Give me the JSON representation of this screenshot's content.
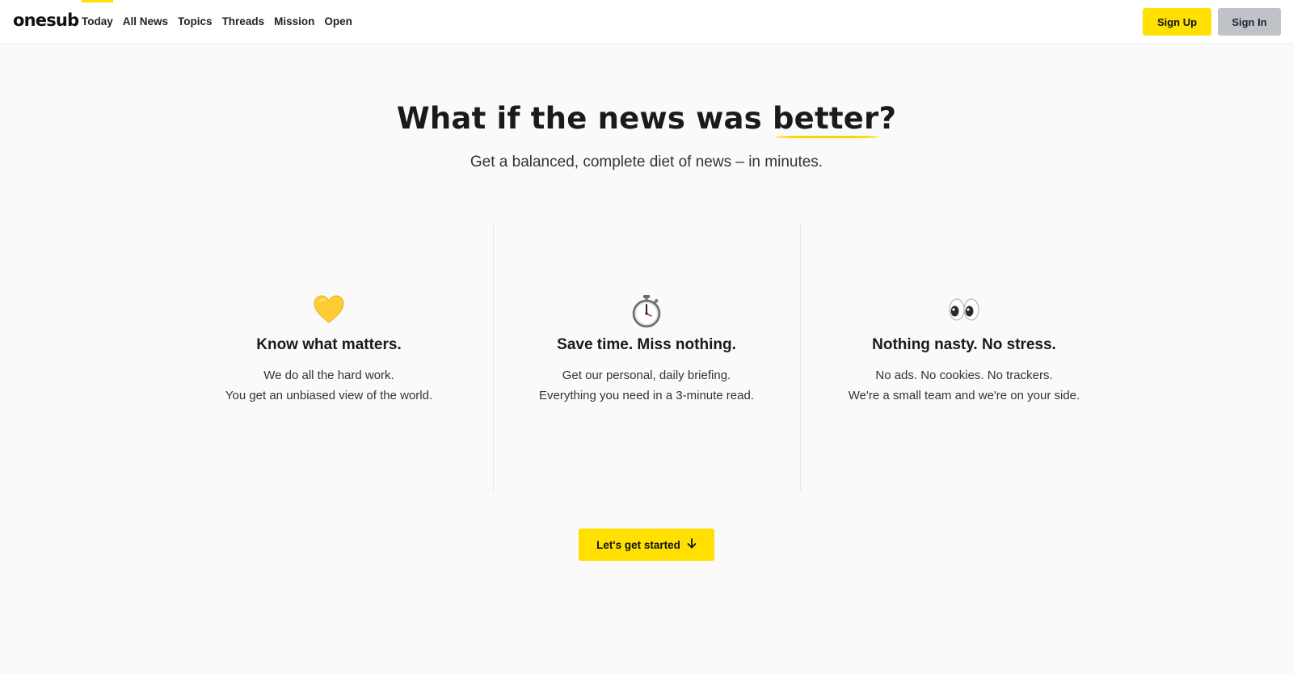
{
  "header": {
    "logo_text": "onesub",
    "nav": [
      {
        "label": "Today",
        "active": true
      },
      {
        "label": "All News"
      },
      {
        "label": "Topics"
      },
      {
        "label": "Threads"
      },
      {
        "label": "Mission"
      },
      {
        "label": "Open"
      }
    ],
    "sign_up_label": "Sign Up",
    "sign_in_label": "Sign In"
  },
  "hero": {
    "title_prefix": "What if the news was ",
    "title_highlight": "better",
    "title_suffix": "?",
    "subtitle": "Get a balanced, complete diet of news – in minutes."
  },
  "features": [
    {
      "icon": "yellow-heart-icon",
      "title": "Know what matters.",
      "line1": "We do all the hard work.",
      "line2": "You get an unbiased view of the world."
    },
    {
      "icon": "stopwatch-icon",
      "title": "Save time. Miss nothing.",
      "line1": "Get our personal, daily briefing.",
      "line2": "Everything you need in a 3-minute read."
    },
    {
      "icon": "eyes-icon",
      "title": "Nothing nasty. No stress.",
      "line1": "No ads. No cookies. No trackers.",
      "line2": "We're a small team and we're on your side."
    }
  ],
  "cta": {
    "label": "Let's get started",
    "icon": "arrow-down-icon"
  },
  "colors": {
    "accent": "#ffe000",
    "sign_in_bg": "#bfc3c8",
    "background": "#fafafa"
  }
}
